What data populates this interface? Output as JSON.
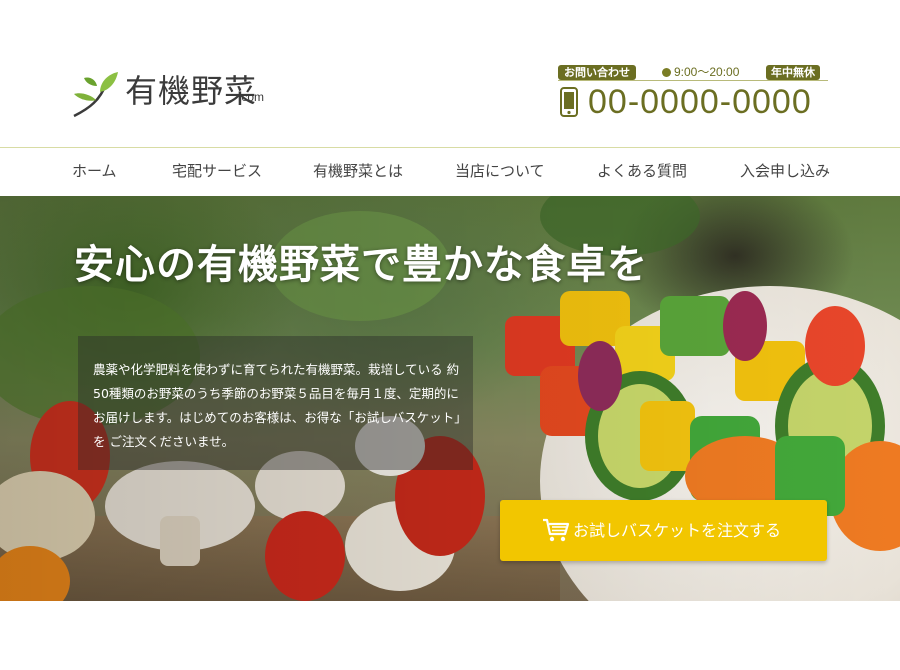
{
  "site": {
    "logo_text": "有機野菜",
    "logo_suffix": ".com",
    "logo_icon": "leaf-sprout-icon"
  },
  "contact": {
    "inquiry_label": "お問い合わせ",
    "hours": "9:00〜20:00",
    "open_label": "年中無休",
    "phone_icon": "smartphone-icon",
    "phone": "00-0000-0000"
  },
  "nav": {
    "items": [
      {
        "label": "ホーム"
      },
      {
        "label": "宅配サービス"
      },
      {
        "label": "有機野菜とは"
      },
      {
        "label": "当店について"
      },
      {
        "label": "よくある質問"
      },
      {
        "label": "入会申し込み"
      }
    ]
  },
  "hero": {
    "title": "安心の有機野菜で豊かな食卓を",
    "description": "農薬や化学肥料を使わずに育てられた有機野菜。栽培している 約50種類のお野菜のうち季節のお野菜５品目を毎月１度、定期的に お届けします。はじめてのお客様は、お得な「お試しバスケット」を ご注文くださいませ。",
    "cta_label": "お試しバスケットを注文する",
    "cta_icon": "shopping-cart-icon"
  },
  "colors": {
    "brand_olive": "#6b6e22",
    "cta_yellow": "#f2c600"
  }
}
